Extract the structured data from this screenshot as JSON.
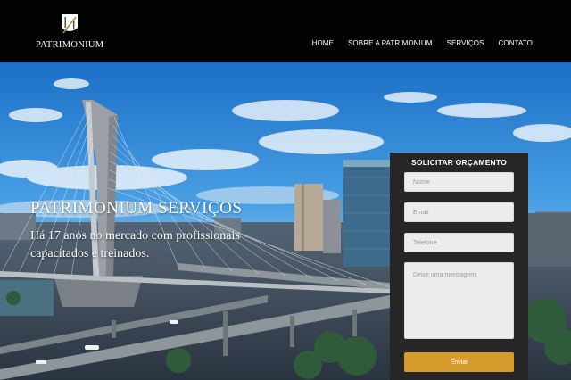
{
  "brand": {
    "name": "PATRIMONIUM"
  },
  "nav": {
    "items": [
      {
        "label": "HOME"
      },
      {
        "label": "SOBRE A PATRIMONIUM"
      },
      {
        "label": "SERVIÇOS"
      },
      {
        "label": "CONTATO"
      }
    ]
  },
  "hero": {
    "title": "PATRIMONIUM SERVIÇOS",
    "subtitle": "Há 17 anos no mercado com profissionais capacitados e treinados."
  },
  "quote_form": {
    "title": "SOLICITAR ORÇAMENTO",
    "name_placeholder": "Nome",
    "email_placeholder": "Email",
    "phone_placeholder": "Telefone",
    "message_placeholder": "Deixe uma mensagem",
    "submit_label": "Enviar",
    "submit_color": "#d79b2b"
  },
  "colors": {
    "header_bg": "#030303",
    "form_bg": "#262626",
    "accent": "#d79b2b"
  }
}
